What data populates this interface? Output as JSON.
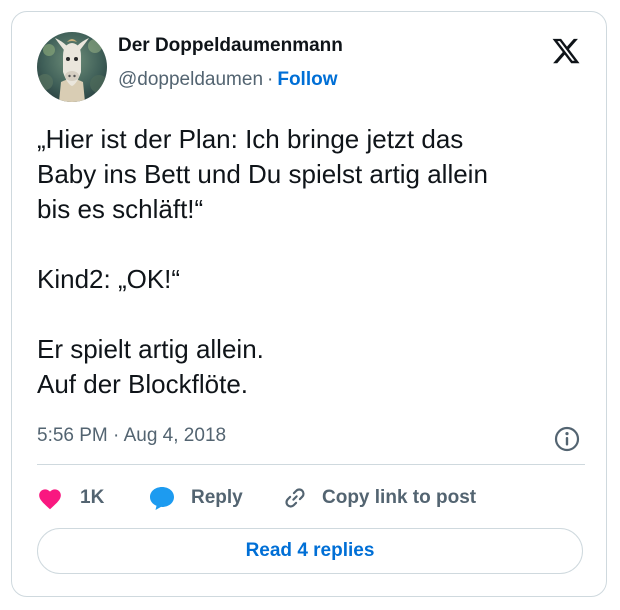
{
  "author": {
    "name": "Der Doppeldaumenmann",
    "handle": "@doppeldaumen",
    "separator": "·",
    "follow_label": "Follow"
  },
  "tweet": {
    "text": "„Hier ist der Plan: Ich bringe jetzt das\nBaby ins Bett und Du spielst artig allein\nbis es schläft!“\n\nKind2: „OK!“\n\nEr spielt artig allein.\nAuf der Blockflöte.",
    "timestamp": "5:56 PM · Aug 4, 2018"
  },
  "actions": {
    "like_count": "1K",
    "reply_label": "Reply",
    "copy_label": "Copy link to post"
  },
  "replies_button": {
    "label": "Read 4 replies"
  },
  "icons": {
    "logo": "x-logo-icon",
    "info": "info-icon",
    "like": "heart-icon",
    "reply": "speech-bubble-icon",
    "copy": "link-icon"
  },
  "colors": {
    "text": "#0f1419",
    "secondary": "#536471",
    "accent": "#006fd6",
    "like": "#f91880",
    "reply": "#1d9bf0",
    "border": "#cfd9de"
  }
}
